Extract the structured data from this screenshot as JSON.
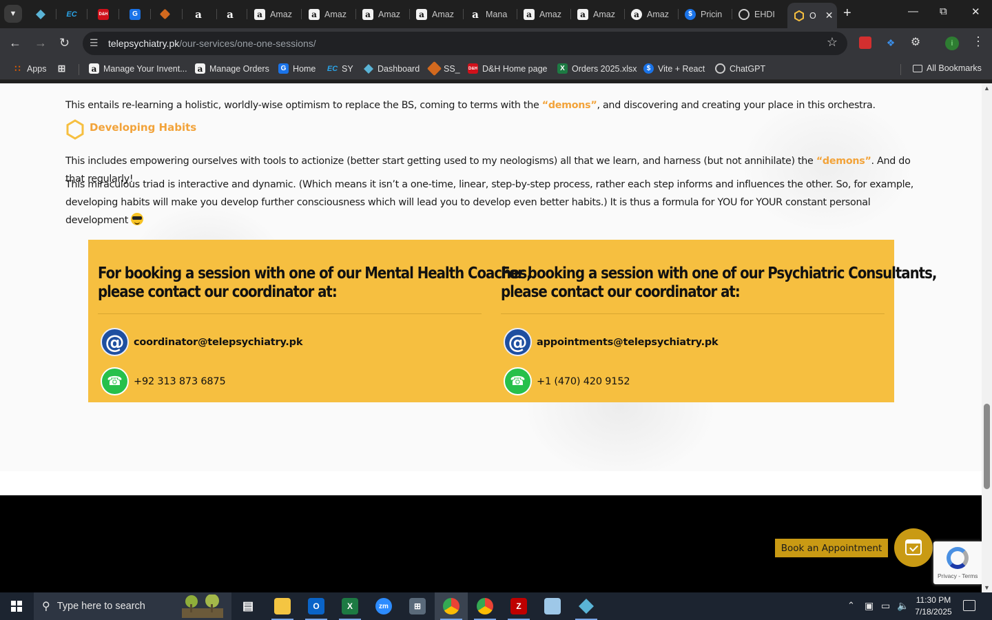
{
  "browser": {
    "tabs": [
      {
        "label": "",
        "icon": "bluegem-icon"
      },
      {
        "label": "",
        "icon": "ec-icon"
      },
      {
        "label": "",
        "icon": "dh-icon"
      },
      {
        "label": "",
        "icon": "g-icon"
      },
      {
        "label": "",
        "icon": "cube-icon"
      },
      {
        "label": "",
        "icon": "amazon-icon"
      },
      {
        "label": "",
        "icon": "amazon-icon"
      },
      {
        "label": "Amaz",
        "icon": "amazon-icon"
      },
      {
        "label": "Amaz",
        "icon": "amazon-icon"
      },
      {
        "label": "Amaz",
        "icon": "amazon-icon"
      },
      {
        "label": "Amaz",
        "icon": "amazon-icon"
      },
      {
        "label": "Mana",
        "icon": "amazon-icon"
      },
      {
        "label": "Amaz",
        "icon": "amazon-icon"
      },
      {
        "label": "Amaz",
        "icon": "amazon-icon"
      },
      {
        "label": "Amaz",
        "icon": "amazon-icon"
      },
      {
        "label": "Pricin",
        "icon": "dollar-icon"
      },
      {
        "label": "EHDI",
        "icon": "chatgpt-icon"
      },
      {
        "label": "O",
        "icon": "hexagon-icon",
        "active": true
      }
    ],
    "url_host": "telepsychiatry.pk",
    "url_path": "/our-services/one-one-sessions/",
    "bookmarks": [
      {
        "label": "Apps",
        "icon": "apps-grid-icon"
      },
      {
        "label": "Manage Your Invent...",
        "icon": "amazon-icon"
      },
      {
        "label": "Manage Orders",
        "icon": "amazon-icon"
      },
      {
        "label": "Home",
        "icon": "g-icon"
      },
      {
        "label": "SY",
        "icon": "ec-icon"
      },
      {
        "label": "Dashboard",
        "icon": "bluegem-icon"
      },
      {
        "label": "SS_",
        "icon": "cube-icon"
      },
      {
        "label": "D&H Home page",
        "icon": "dh-icon"
      },
      {
        "label": "Orders 2025.xlsx",
        "icon": "excel-icon"
      },
      {
        "label": "Vite + React",
        "icon": "dollar-icon"
      },
      {
        "label": "ChatGPT",
        "icon": "chatgpt-icon"
      }
    ],
    "all_bookmarks": "All Bookmarks"
  },
  "page": {
    "para1_before": "This entails re-learning a holistic, worldly-wise optimism to replace the BS, coming to terms with the ",
    "para1_highlight": "“demons”",
    "para1_after": ", and discovering and creating your place in this orchestra.",
    "habits_heading": "Developing Habits",
    "para2_before": "This includes empowering ourselves with tools to actionize (better start getting used to my neologisms) all that we learn, and harness (but not annihilate) the ",
    "para2_highlight": "“demons”",
    "para2_after": ". And do that regularly!",
    "para3": "This miraculous triad is interactive and dynamic. (Which means it isn’t a one-time, linear, step-by-step process, rather each step informs and influences the other. So, for example, developing habits will make you develop further consciousness which will lead you to develop even better habits.) It is thus a formula for YOU for YOUR constant personal development",
    "booking": {
      "coaches_title_line1": "For booking a session with one of our Mental Health Coaches,",
      "coaches_title_line2": "please contact our coordinator at:",
      "coaches_email": "coordinator@telepsychiatry.pk",
      "coaches_phone": "+92 313 873 6875",
      "consultants_title_line1": "For booking a session with one of our Psychiatric Consultants,",
      "consultants_title_line2": "please contact our coordinator at:",
      "consultants_email": "appointments@telepsychiatry.pk",
      "consultants_phone": "+1 (470) 420 9152"
    },
    "book_button": "Book an Appointment",
    "recaptcha_links": "Privacy - Terms"
  },
  "taskbar": {
    "search_placeholder": "Type here to search",
    "time": "11:30 PM",
    "date": "7/18/2025"
  },
  "colors": {
    "accent_orange": "#f2a33a",
    "booking_yellow": "#f6bf40",
    "button_gold": "#c99a14"
  }
}
